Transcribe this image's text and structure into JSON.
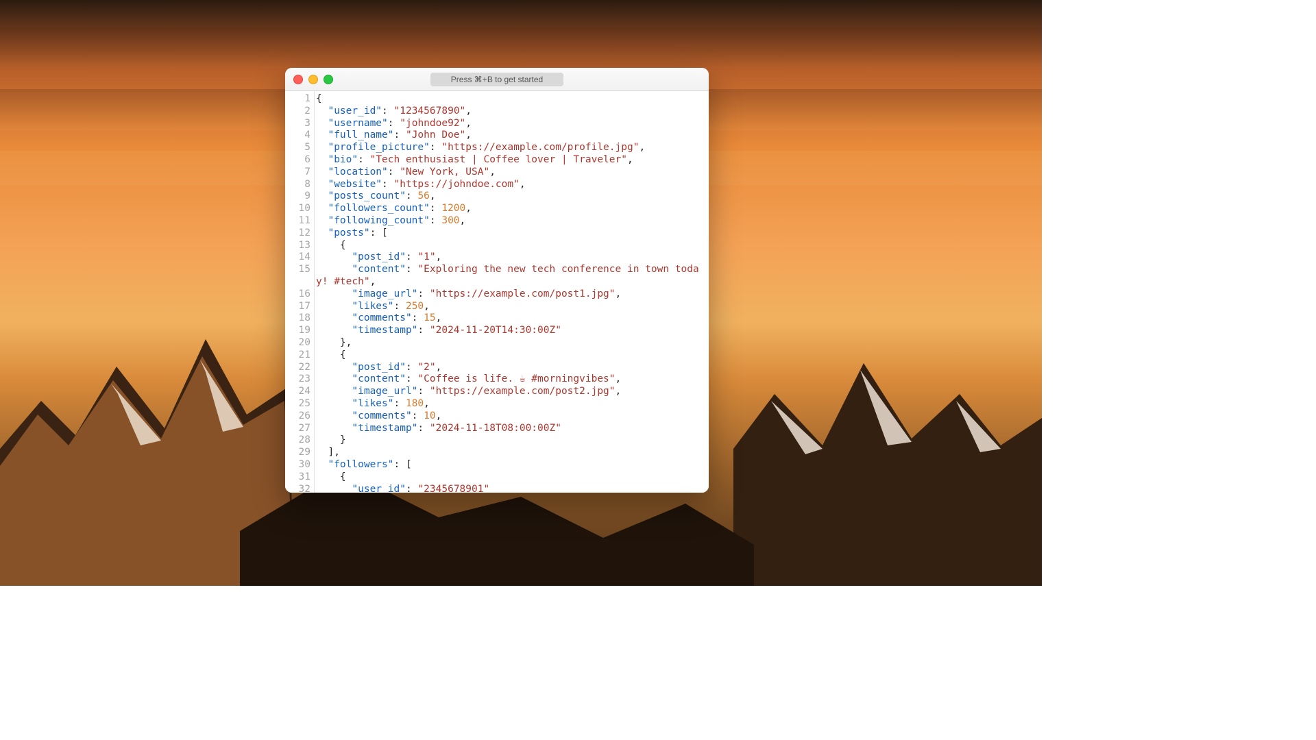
{
  "titlebar": {
    "hint": "Press ⌘+B to get started"
  },
  "syntax_colors": {
    "key": "#1560c0",
    "string": "#b1362e",
    "number": "#d97b2e",
    "punct": "#222222"
  },
  "lines": [
    {
      "n": 1,
      "tokens": [
        [
          "p",
          "{"
        ]
      ]
    },
    {
      "n": 2,
      "tokens": [
        [
          "p",
          "  "
        ],
        [
          "k",
          "\"user_id\""
        ],
        [
          "p",
          ": "
        ],
        [
          "s",
          "\"1234567890\""
        ],
        [
          "p",
          ","
        ]
      ]
    },
    {
      "n": 3,
      "tokens": [
        [
          "p",
          "  "
        ],
        [
          "k",
          "\"username\""
        ],
        [
          "p",
          ": "
        ],
        [
          "s",
          "\"johndoe92\""
        ],
        [
          "p",
          ","
        ]
      ]
    },
    {
      "n": 4,
      "tokens": [
        [
          "p",
          "  "
        ],
        [
          "k",
          "\"full_name\""
        ],
        [
          "p",
          ": "
        ],
        [
          "s",
          "\"John Doe\""
        ],
        [
          "p",
          ","
        ]
      ]
    },
    {
      "n": 5,
      "tokens": [
        [
          "p",
          "  "
        ],
        [
          "k",
          "\"profile_picture\""
        ],
        [
          "p",
          ": "
        ],
        [
          "s",
          "\"https://example.com/profile.jpg\""
        ],
        [
          "p",
          ","
        ]
      ]
    },
    {
      "n": 6,
      "tokens": [
        [
          "p",
          "  "
        ],
        [
          "k",
          "\"bio\""
        ],
        [
          "p",
          ": "
        ],
        [
          "s",
          "\"Tech enthusiast | Coffee lover | Traveler\""
        ],
        [
          "p",
          ","
        ]
      ]
    },
    {
      "n": 7,
      "tokens": [
        [
          "p",
          "  "
        ],
        [
          "k",
          "\"location\""
        ],
        [
          "p",
          ": "
        ],
        [
          "s",
          "\"New York, USA\""
        ],
        [
          "p",
          ","
        ]
      ]
    },
    {
      "n": 8,
      "tokens": [
        [
          "p",
          "  "
        ],
        [
          "k",
          "\"website\""
        ],
        [
          "p",
          ": "
        ],
        [
          "s",
          "\"https://johndoe.com\""
        ],
        [
          "p",
          ","
        ]
      ]
    },
    {
      "n": 9,
      "tokens": [
        [
          "p",
          "  "
        ],
        [
          "k",
          "\"posts_count\""
        ],
        [
          "p",
          ": "
        ],
        [
          "n",
          "56"
        ],
        [
          "p",
          ","
        ]
      ]
    },
    {
      "n": 10,
      "tokens": [
        [
          "p",
          "  "
        ],
        [
          "k",
          "\"followers_count\""
        ],
        [
          "p",
          ": "
        ],
        [
          "n",
          "1200"
        ],
        [
          "p",
          ","
        ]
      ]
    },
    {
      "n": 11,
      "tokens": [
        [
          "p",
          "  "
        ],
        [
          "k",
          "\"following_count\""
        ],
        [
          "p",
          ": "
        ],
        [
          "n",
          "300"
        ],
        [
          "p",
          ","
        ]
      ]
    },
    {
      "n": 12,
      "tokens": [
        [
          "p",
          "  "
        ],
        [
          "k",
          "\"posts\""
        ],
        [
          "p",
          ": ["
        ]
      ]
    },
    {
      "n": 13,
      "tokens": [
        [
          "p",
          "    {"
        ]
      ]
    },
    {
      "n": 14,
      "tokens": [
        [
          "p",
          "      "
        ],
        [
          "k",
          "\"post_id\""
        ],
        [
          "p",
          ": "
        ],
        [
          "s",
          "\"1\""
        ],
        [
          "p",
          ","
        ]
      ]
    },
    {
      "n": 15,
      "wrap": true,
      "tokens": [
        [
          "p",
          "      "
        ],
        [
          "k",
          "\"content\""
        ],
        [
          "p",
          ": "
        ],
        [
          "s",
          "\"Exploring the new tech conference in town today! #tech\""
        ],
        [
          "p",
          ","
        ]
      ]
    },
    {
      "n": 16,
      "tokens": [
        [
          "p",
          "      "
        ],
        [
          "k",
          "\"image_url\""
        ],
        [
          "p",
          ": "
        ],
        [
          "s",
          "\"https://example.com/post1.jpg\""
        ],
        [
          "p",
          ","
        ]
      ]
    },
    {
      "n": 17,
      "tokens": [
        [
          "p",
          "      "
        ],
        [
          "k",
          "\"likes\""
        ],
        [
          "p",
          ": "
        ],
        [
          "n",
          "250"
        ],
        [
          "p",
          ","
        ]
      ]
    },
    {
      "n": 18,
      "tokens": [
        [
          "p",
          "      "
        ],
        [
          "k",
          "\"comments\""
        ],
        [
          "p",
          ": "
        ],
        [
          "n",
          "15"
        ],
        [
          "p",
          ","
        ]
      ]
    },
    {
      "n": 19,
      "tokens": [
        [
          "p",
          "      "
        ],
        [
          "k",
          "\"timestamp\""
        ],
        [
          "p",
          ": "
        ],
        [
          "s",
          "\"2024-11-20T14:30:00Z\""
        ]
      ]
    },
    {
      "n": 20,
      "tokens": [
        [
          "p",
          "    },"
        ]
      ]
    },
    {
      "n": 21,
      "tokens": [
        [
          "p",
          "    {"
        ]
      ]
    },
    {
      "n": 22,
      "tokens": [
        [
          "p",
          "      "
        ],
        [
          "k",
          "\"post_id\""
        ],
        [
          "p",
          ": "
        ],
        [
          "s",
          "\"2\""
        ],
        [
          "p",
          ","
        ]
      ]
    },
    {
      "n": 23,
      "tokens": [
        [
          "p",
          "      "
        ],
        [
          "k",
          "\"content\""
        ],
        [
          "p",
          ": "
        ],
        [
          "s",
          "\"Coffee is life. ☕ #morningvibes\""
        ],
        [
          "p",
          ","
        ]
      ]
    },
    {
      "n": 24,
      "tokens": [
        [
          "p",
          "      "
        ],
        [
          "k",
          "\"image_url\""
        ],
        [
          "p",
          ": "
        ],
        [
          "s",
          "\"https://example.com/post2.jpg\""
        ],
        [
          "p",
          ","
        ]
      ]
    },
    {
      "n": 25,
      "tokens": [
        [
          "p",
          "      "
        ],
        [
          "k",
          "\"likes\""
        ],
        [
          "p",
          ": "
        ],
        [
          "n",
          "180"
        ],
        [
          "p",
          ","
        ]
      ]
    },
    {
      "n": 26,
      "tokens": [
        [
          "p",
          "      "
        ],
        [
          "k",
          "\"comments\""
        ],
        [
          "p",
          ": "
        ],
        [
          "n",
          "10"
        ],
        [
          "p",
          ","
        ]
      ]
    },
    {
      "n": 27,
      "tokens": [
        [
          "p",
          "      "
        ],
        [
          "k",
          "\"timestamp\""
        ],
        [
          "p",
          ": "
        ],
        [
          "s",
          "\"2024-11-18T08:00:00Z\""
        ]
      ]
    },
    {
      "n": 28,
      "tokens": [
        [
          "p",
          "    }"
        ]
      ]
    },
    {
      "n": 29,
      "tokens": [
        [
          "p",
          "  ],"
        ]
      ]
    },
    {
      "n": 30,
      "tokens": [
        [
          "p",
          "  "
        ],
        [
          "k",
          "\"followers\""
        ],
        [
          "p",
          ": ["
        ]
      ]
    },
    {
      "n": 31,
      "tokens": [
        [
          "p",
          "    {"
        ]
      ]
    },
    {
      "n": 32,
      "tokens": [
        [
          "p",
          "      "
        ],
        [
          "k",
          "\"user_id\""
        ],
        [
          "p",
          ": "
        ],
        [
          "s",
          "\"2345678901\""
        ]
      ]
    }
  ]
}
